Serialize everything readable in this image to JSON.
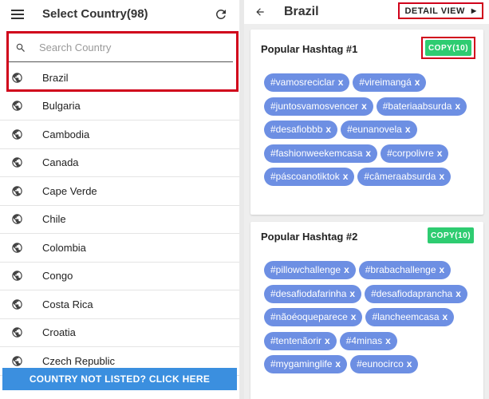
{
  "left": {
    "title": "Select Country(98)",
    "search": {
      "placeholder": "Search Country",
      "value": ""
    },
    "countries": [
      "Brazil",
      "Bulgaria",
      "Cambodia",
      "Canada",
      "Cape Verde",
      "Chile",
      "Colombia",
      "Congo",
      "Costa Rica",
      "Croatia",
      "Czech Republic"
    ],
    "bottom_button": "COUNTRY NOT LISTED? CLICK HERE"
  },
  "right": {
    "title": "Brazil",
    "detail_button": "DETAIL VIEW",
    "cards": [
      {
        "title": "Popular Hashtag #1",
        "copy_label": "COPY(10)",
        "tags": [
          "#vamosreciclar",
          "#vireimangá",
          "#juntosvamosvencer",
          "#bateriaabsurda",
          "#desafiobbb",
          "#eunanovela",
          "#fashionweekemcasa",
          "#corpolivre",
          "#páscoanotiktok",
          "#câmeraabsurda"
        ]
      },
      {
        "title": "Popular Hashtag #2",
        "copy_label": "COPY(10)",
        "tags": [
          "#pillowchallenge",
          "#brabachallenge",
          "#desafiodafarinha",
          "#desafiodaprancha",
          "#nãoéoqueparece",
          "#lancheemcasa",
          "#tentenãorir",
          "#4minas",
          "#mygaminglife",
          "#eunocirco"
        ]
      }
    ]
  },
  "tag_remove_label": "x",
  "colors": {
    "accent": "#3b8fdf",
    "tag": "#6d8fe3",
    "copy": "#2ecc71",
    "highlight": "#d0021b"
  }
}
